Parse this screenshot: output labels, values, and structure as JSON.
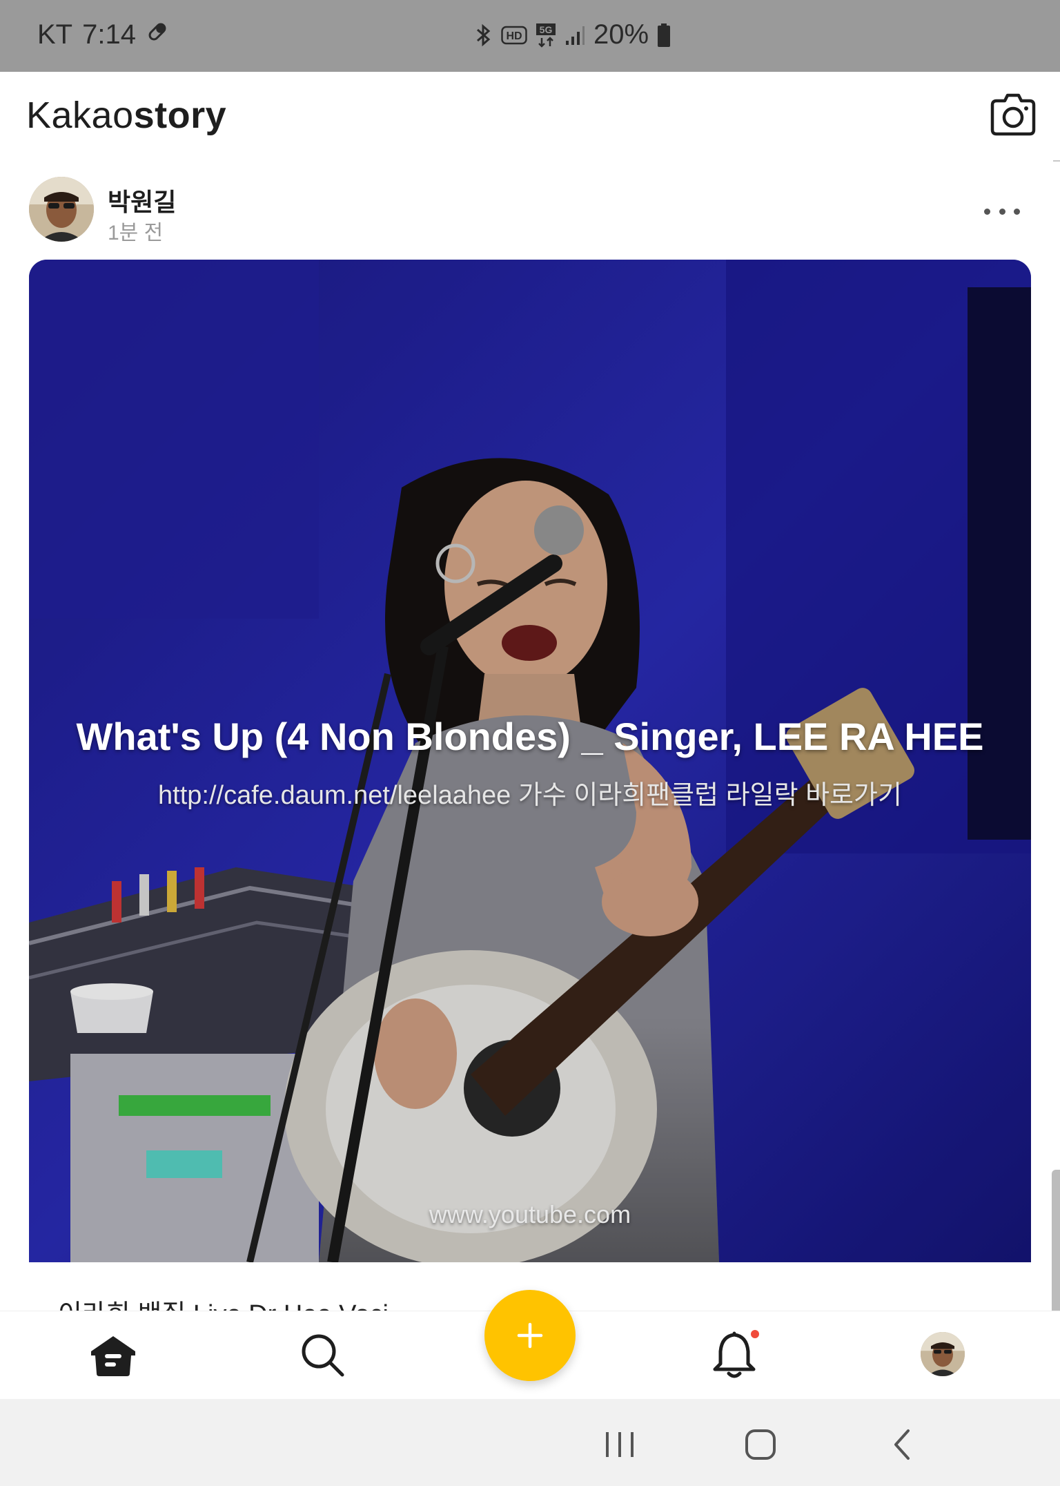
{
  "status_bar": {
    "carrier": "KT",
    "time": "7:14",
    "battery": "20%",
    "icons": [
      "pill-icon",
      "bluetooth-icon",
      "hd-icon",
      "5g-icon",
      "signal-icon",
      "battery-icon"
    ]
  },
  "app": {
    "brand_light": "Kakao",
    "brand_bold": "story",
    "camera_icon": "camera-icon"
  },
  "post": {
    "author": "박원길",
    "time": "1분 전",
    "more_icon": "more-dots-icon",
    "link_preview": {
      "title": "What's Up (4 Non Blondes) _ Singer, LEE RA HEE",
      "description": "http://cafe.daum.net/leelaahee   가수 이라희팬클럽 라일락 바로가기",
      "domain": "www.youtube.com"
    },
    "text": "이라희 밴질 Live Dr Hee Voci"
  },
  "bottom_nav": {
    "items": [
      "home-icon",
      "search-icon",
      "add-icon",
      "bell-icon",
      "profile-avatar"
    ],
    "has_notification": true
  },
  "system_nav": [
    "recent-apps-icon",
    "home-circle-icon",
    "back-icon"
  ],
  "colors": {
    "fab": "#ffc300",
    "notification_dot": "#f04a3a",
    "status_bar": "#9a9a9a"
  }
}
